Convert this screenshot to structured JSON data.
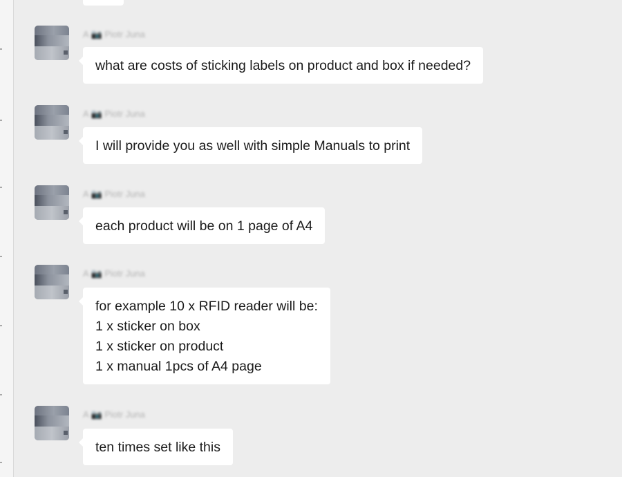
{
  "sender_name": "A 📷 Piotr Juna",
  "messages": [
    {
      "lines": [
        "what are costs of sticking labels on product and box if needed?"
      ]
    },
    {
      "lines": [
        "I will provide you as well with simple Manuals to print"
      ]
    },
    {
      "lines": [
        "each product will be on 1 page of A4"
      ]
    },
    {
      "lines": [
        "for example 10 x RFID reader will be:",
        "1 x sticker on box",
        "1 x sticker on product",
        "1 x manual 1pcs of A4 page"
      ]
    },
    {
      "lines": [
        "ten times set like this"
      ]
    }
  ],
  "colors": {
    "background": "#ededed",
    "bubble": "#ffffff",
    "text": "#1a1a1a",
    "sender_name": "#b3b3b3"
  }
}
